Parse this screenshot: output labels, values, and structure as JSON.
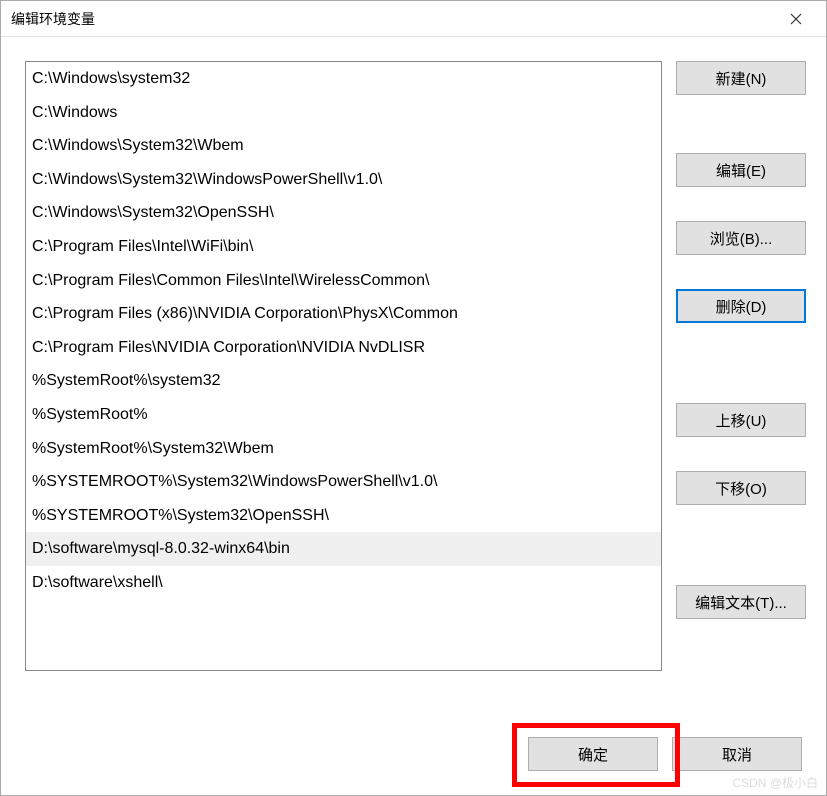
{
  "window": {
    "title": "编辑环境变量"
  },
  "list": {
    "selectedIndex": 14,
    "items": [
      "C:\\Windows\\system32",
      "C:\\Windows",
      "C:\\Windows\\System32\\Wbem",
      "C:\\Windows\\System32\\WindowsPowerShell\\v1.0\\",
      "C:\\Windows\\System32\\OpenSSH\\",
      "C:\\Program Files\\Intel\\WiFi\\bin\\",
      "C:\\Program Files\\Common Files\\Intel\\WirelessCommon\\",
      "C:\\Program Files (x86)\\NVIDIA Corporation\\PhysX\\Common",
      "C:\\Program Files\\NVIDIA Corporation\\NVIDIA NvDLISR",
      "%SystemRoot%\\system32",
      "%SystemRoot%",
      "%SystemRoot%\\System32\\Wbem",
      "%SYSTEMROOT%\\System32\\WindowsPowerShell\\v1.0\\",
      "%SYSTEMROOT%\\System32\\OpenSSH\\",
      "D:\\software\\mysql-8.0.32-winx64\\bin",
      "D:\\software\\xshell\\"
    ]
  },
  "buttons": {
    "new": "新建(N)",
    "edit": "编辑(E)",
    "browse": "浏览(B)...",
    "delete": "删除(D)",
    "moveUp": "上移(U)",
    "moveDown": "下移(O)",
    "editText": "编辑文本(T)...",
    "ok": "确定",
    "cancel": "取消"
  },
  "watermark": "CSDN @极小白"
}
